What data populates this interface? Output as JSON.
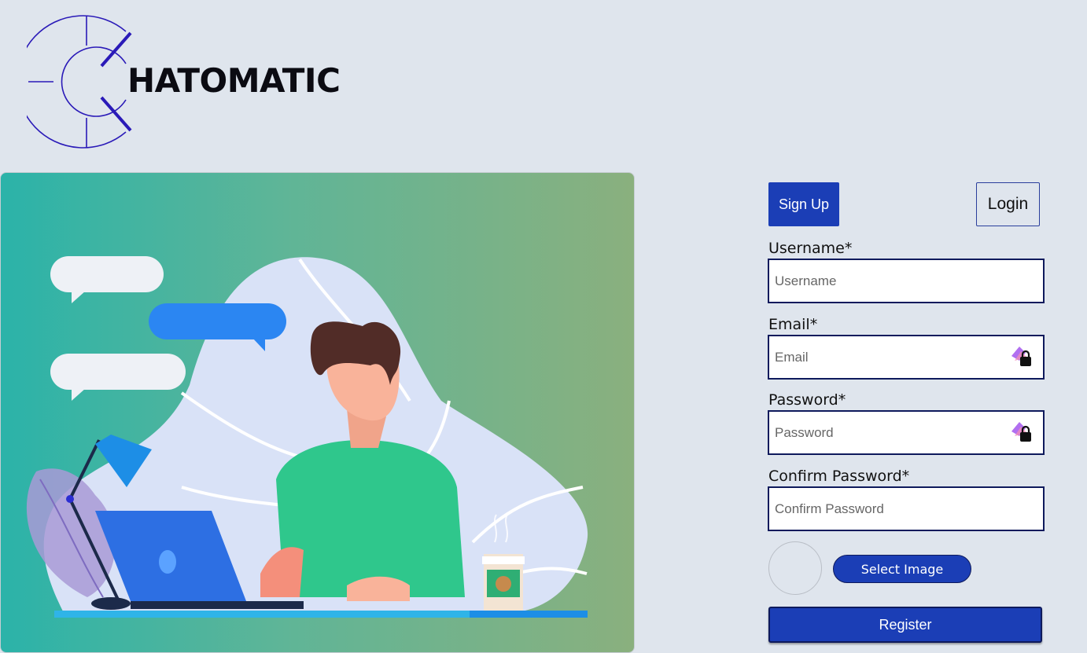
{
  "brand": {
    "name": "HATOMATIC"
  },
  "auth_tabs": {
    "signup_label": "Sign Up",
    "login_label": "Login"
  },
  "form": {
    "username": {
      "label": "Username*",
      "placeholder": "Username"
    },
    "email": {
      "label": "Email*",
      "placeholder": "Email"
    },
    "password": {
      "label": "Password*",
      "placeholder": "Password"
    },
    "confirm_password": {
      "label": "Confirm Password*",
      "placeholder": "Confirm Password"
    },
    "select_image_label": "Select Image",
    "register_label": "Register"
  },
  "icons": {
    "logo": "c-logo-icon",
    "password_manager": "password-manager-lock-icon"
  },
  "colors": {
    "accent": "#1b3eb6",
    "background": "#dfe5ed",
    "logo_stroke": "#2a1ab8"
  }
}
